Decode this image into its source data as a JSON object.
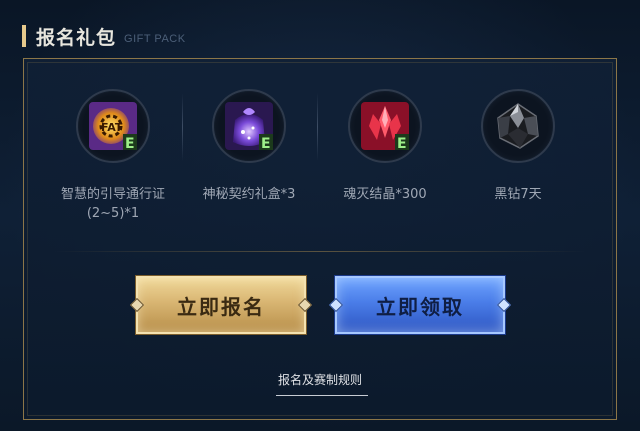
{
  "header": {
    "title": "报名礼包",
    "subtitle": "GIFT PACK",
    "accent_color": "#e6c98c"
  },
  "rewards": [
    {
      "label": "智慧的引导通行证(2~5)*1",
      "icon": "guidance-pass-icon"
    },
    {
      "label": "神秘契约礼盒*3",
      "icon": "mystery-contract-giftbox-icon"
    },
    {
      "label": "魂灭结晶*300",
      "icon": "soul-crystal-icon"
    },
    {
      "label": "黑钻7天",
      "icon": "black-diamond-icon"
    }
  ],
  "buttons": {
    "signup_label": "立即报名",
    "claim_label": "立即领取"
  },
  "rules_link": "报名及赛制规则",
  "colors": {
    "panel_border": "#8c7648",
    "gold_button": "#d8b572",
    "blue_button": "#4a7de8",
    "background": "#0c1a2c"
  }
}
